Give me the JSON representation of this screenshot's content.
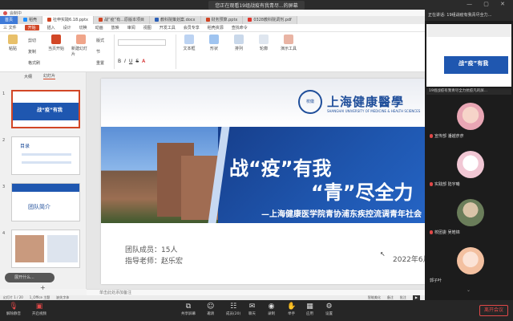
{
  "meeting": {
    "sharing_banner": "您正在观看19组战疫有我青尽...的屏幕",
    "speaker_label": "正在讲话: 19组战疫有我青尽全力...",
    "sharing_label": "19组战疫有我青尽全力抗疫凡的屏...",
    "participants": [
      {
        "name": "宣传部 潘越彦彦"
      },
      {
        "name": "实践部 陆宇曦"
      },
      {
        "name": "校团委 吴皓锦"
      },
      {
        "name": "郭子叶"
      }
    ],
    "toolbar": [
      {
        "label": "解除静音"
      },
      {
        "label": "开启视频"
      },
      {
        "label": "共享屏幕"
      },
      {
        "label": "邀请"
      },
      {
        "label": "成员(20)"
      },
      {
        "label": "聊天"
      },
      {
        "label": "录制"
      },
      {
        "label": "举手"
      },
      {
        "label": "应用"
      },
      {
        "label": "设置"
      }
    ],
    "leave_label": "离开会议"
  },
  "app": {
    "title_bar": "会制中",
    "tabs": [
      {
        "label": "首页"
      },
      {
        "label": "稻壳"
      },
      {
        "label": "社申实践6.18.pptx"
      },
      {
        "label": "战“疫”有...原版本项目"
      },
      {
        "label": "教科院策划案.docx"
      },
      {
        "label": "财务预算.pptx"
      },
      {
        "label": "0328教科院调剂.pdf"
      }
    ],
    "menu": [
      {
        "label": "三 文件"
      },
      {
        "label": "开始"
      },
      {
        "label": "插入"
      },
      {
        "label": "设计"
      },
      {
        "label": "切换"
      },
      {
        "label": "动画"
      },
      {
        "label": "放映"
      },
      {
        "label": "审阅"
      },
      {
        "label": "视图"
      },
      {
        "label": "开发工具"
      },
      {
        "label": "会员专享"
      },
      {
        "label": "稻壳资源"
      },
      {
        "label": "查找命令"
      }
    ],
    "ribbon": {
      "paste": "粘贴",
      "cut": "剪切",
      "copy": "复制",
      "format_painter": "格式刷",
      "from_start": "当页开始",
      "new_slide": "新建幻灯片",
      "layout": "版式",
      "section": "节",
      "reset": "重置",
      "font_placeholder": "",
      "text_box": "文本框",
      "shapes": "形状",
      "arrange": "排列",
      "outline": "轮廓",
      "present_tools": "演示工具"
    },
    "left_panel": {
      "tab_outline": "大纲",
      "tab_slides": "幻灯片",
      "slide_numbers": [
        "1",
        "2",
        "3",
        "4"
      ],
      "thumb_titles": [
        "战“疫”有我",
        "目录",
        "团队简介",
        ""
      ],
      "collapse_hint": "展开什么..."
    },
    "slide": {
      "logo_text": "上海健康醫學",
      "logo_sub": "SHANGHAI UNIVERSITY OF MEDICINE & HEALTH SCIENCES",
      "logo_mark": "校徽",
      "title_line1": "战“疫”有我",
      "title_line2": "“青”尽全力",
      "title_line3": "—上海健康医学院青协浦东疾控流调青年社会",
      "members": "团队成员：15人",
      "advisor": "指导老师：赵乐宏",
      "date": "2022年6月"
    },
    "notes_hint": "单击此处添加备注",
    "status": {
      "slide_count": "幻灯片 1 / 20",
      "theme": "1_Office 主题",
      "missing_font": "缺失字体",
      "smart_beautify": "智能美化",
      "notes": "备注",
      "comments": "批注"
    }
  },
  "colors": {
    "accent": "#d24726",
    "slide_blue": "#1f57b0",
    "leave_red": "#e04848"
  }
}
